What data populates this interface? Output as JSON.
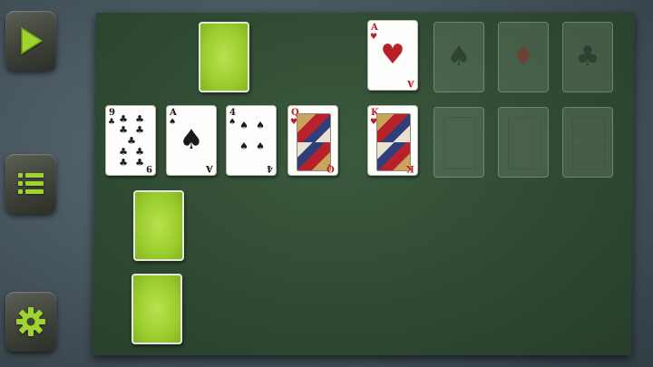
{
  "sidebar": {
    "buttons": [
      {
        "name": "play-button",
        "icon": "play-icon"
      },
      {
        "name": "menu-button",
        "icon": "list-icon"
      },
      {
        "name": "settings-button",
        "icon": "gear-icon"
      }
    ],
    "accent": "#9fd32f"
  },
  "cards": {
    "stock": {
      "state": "face-down"
    },
    "tableau": [
      {
        "rank": "9",
        "suit": "clubs",
        "glyph": "♣",
        "color": "blk"
      },
      {
        "rank": "A",
        "suit": "spades",
        "glyph": "♠",
        "color": "blk"
      },
      {
        "rank": "4",
        "suit": "spades",
        "glyph": "♠",
        "color": "blk"
      },
      {
        "rank": "Q",
        "suit": "hearts",
        "glyph": "♥",
        "color": "red"
      }
    ],
    "foundation_top": [
      {
        "rank": "A",
        "suit": "hearts",
        "glyph": "♥",
        "color": "red",
        "state": "face-up"
      },
      {
        "suit": "spades",
        "glyph": "♠",
        "state": "placeholder"
      },
      {
        "suit": "diamonds",
        "glyph": "♦",
        "state": "placeholder"
      },
      {
        "suit": "clubs",
        "glyph": "♣",
        "state": "placeholder"
      }
    ],
    "foundation_bottom": [
      {
        "rank": "K",
        "suit": "hearts",
        "glyph": "♥",
        "color": "red",
        "state": "face-up"
      },
      {
        "state": "placeholder"
      },
      {
        "state": "placeholder"
      },
      {
        "state": "placeholder"
      }
    ],
    "side_piles": [
      {
        "state": "face-down"
      },
      {
        "state": "face-down"
      }
    ]
  }
}
